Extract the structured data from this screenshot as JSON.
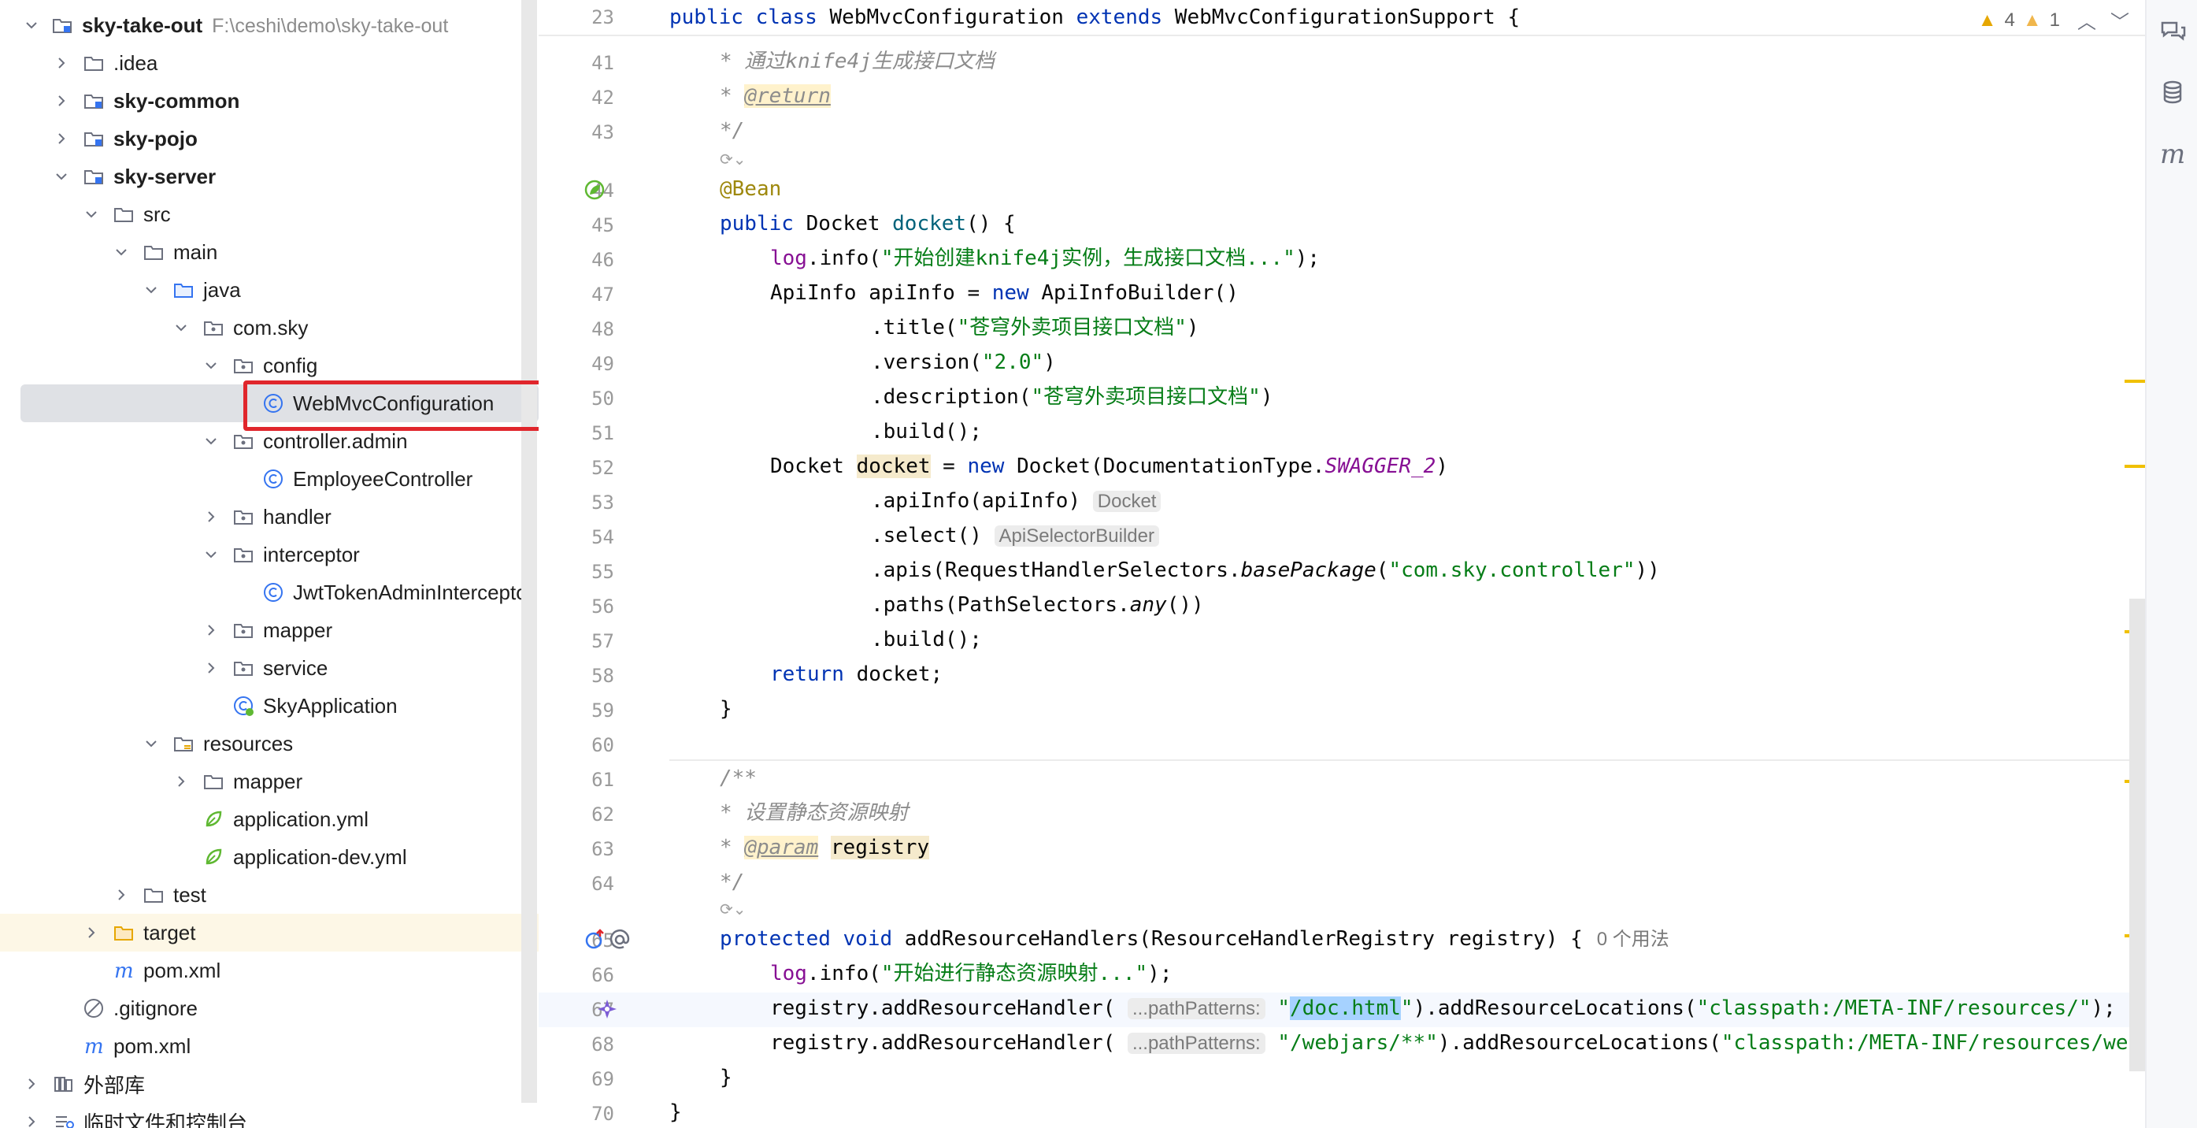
{
  "project_tree": {
    "root": {
      "label": "sky-take-out",
      "path": "F:\\ceshi\\demo\\sky-take-out"
    },
    "items": [
      {
        "label": ".idea"
      },
      {
        "label": "sky-common"
      },
      {
        "label": "sky-pojo"
      },
      {
        "label": "sky-server"
      },
      {
        "label": "src"
      },
      {
        "label": "main"
      },
      {
        "label": "java"
      },
      {
        "label": "com.sky"
      },
      {
        "label": "config"
      },
      {
        "label": "WebMvcConfiguration"
      },
      {
        "label": "controller.admin"
      },
      {
        "label": "EmployeeController"
      },
      {
        "label": "handler"
      },
      {
        "label": "interceptor"
      },
      {
        "label": "JwtTokenAdminInterceptor"
      },
      {
        "label": "mapper"
      },
      {
        "label": "service"
      },
      {
        "label": "SkyApplication"
      },
      {
        "label": "resources"
      },
      {
        "label": "mapper"
      },
      {
        "label": "application.yml"
      },
      {
        "label": "application-dev.yml"
      },
      {
        "label": "test"
      },
      {
        "label": "target"
      },
      {
        "label": "pom.xml"
      },
      {
        "label": ".gitignore"
      },
      {
        "label": "pom.xml"
      },
      {
        "label": "外部库"
      },
      {
        "label": "临时文件和控制台"
      }
    ]
  },
  "editor": {
    "sticky": {
      "line": "23",
      "code": "public class WebMvcConfiguration extends WebMvcConfigurationSupport {"
    },
    "inspection": {
      "warnings": "4",
      "weak_warnings": "1"
    },
    "line_numbers": [
      "41",
      "42",
      "43",
      "44",
      "45",
      "46",
      "47",
      "48",
      "49",
      "50",
      "51",
      "52",
      "53",
      "54",
      "55",
      "56",
      "57",
      "58",
      "59",
      "60",
      "61",
      "62",
      "63",
      "64",
      "65",
      "66",
      "67",
      "68",
      "69",
      "70"
    ],
    "lines": {
      "l41": "* 通过knife4j生成接口文档",
      "l42_tag": "@return",
      "l43": "*/",
      "l44": "@Bean",
      "l45_kw": "public",
      "l45_rest": " Docket ",
      "l45_name": "docket",
      "l45_end": "() {",
      "l46_field": "log",
      "l46_a": ".info(",
      "l46_str": "\"开始创建knife4j实例，生成接口文档...\"",
      "l46_end": ");",
      "l47_a": "ApiInfo apiInfo = ",
      "l47_kw": "new",
      "l47_b": " ApiInfoBuilder()",
      "l48_a": ".title(",
      "l48_str": "\"苍穹外卖项目接口文档\"",
      "l48_end": ")",
      "l49_a": ".version(",
      "l49_str": "\"2.0\"",
      "l49_end": ")",
      "l50_a": ".description(",
      "l50_str": "\"苍穹外卖项目接口文档\"",
      "l50_end": ")",
      "l51": ".build();",
      "l52_a": "Docket ",
      "l52_var": "docket",
      "l52_b": " = ",
      "l52_kw": "new",
      "l52_c": " Docket(DocumentationType.",
      "l52_static": "SWAGGER_2",
      "l52_end": ")",
      "l53_a": ".apiInfo(apiInfo)",
      "l53_hint": "Docket",
      "l54_a": ".select()",
      "l54_hint": "ApiSelectorBuilder",
      "l55_a": ".apis(RequestHandlerSelectors.",
      "l55_it": "basePackage",
      "l55_b": "(",
      "l55_str": "\"com.sky.controller\"",
      "l55_end": "))",
      "l56_a": ".paths(PathSelectors.",
      "l56_it": "any",
      "l56_end": "())",
      "l57": ".build();",
      "l58_kw": "return",
      "l58_rest": " docket;",
      "l59": "}",
      "l61": "/**",
      "l62": "* 设置静态资源映射",
      "l63_star": "* ",
      "l63_tag": "@param",
      "l63_var": "registry",
      "l64": "*/",
      "l65_kw": "protected void",
      "l65_rest": " addResourceHandlers(ResourceHandlerRegistry registry) {",
      "l65_usage": "0 个用法",
      "l66_field": "log",
      "l66_a": ".info(",
      "l66_str": "\"开始进行静态资源映射...\"",
      "l66_end": ");",
      "l67_a": "registry.addResourceHandler(",
      "l67_hint": "...pathPatterns:",
      "l67_q1": "\"",
      "l67_sel": "/doc.html",
      "l67_q2": "\"",
      "l67_b": ").addResourceLocations(",
      "l67_str": "\"classpath:/META-INF/resources/\"",
      "l67_end": ");",
      "l68_a": "registry.addResourceHandler(",
      "l68_hint": "...pathPatterns:",
      "l68_str1": "\"/webjars/**\"",
      "l68_b": ").addResourceLocations(",
      "l68_str2": "\"classpath:/META-INF/resources/we",
      "l69": "}",
      "l70": "}"
    }
  },
  "colors": {
    "selection_box": "#e0262c",
    "keyword": "#0033b3",
    "string": "#067d17",
    "comment": "#8c8c8c",
    "annotation": "#9e880d"
  }
}
